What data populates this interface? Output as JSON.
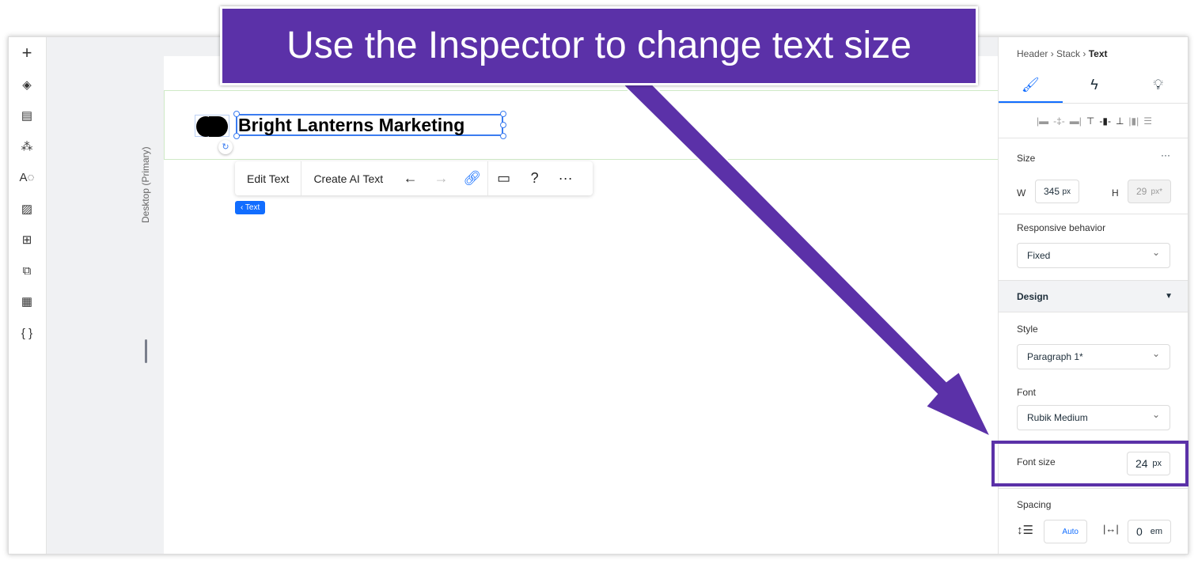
{
  "callout": {
    "text": "Use the Inspector to change text size",
    "color": "#5b31a8"
  },
  "leftbar": {
    "icons": [
      "plus-icon",
      "layers-icon",
      "page-icon",
      "components-icon",
      "typography-icon",
      "image-icon",
      "apps-icon",
      "app-market-icon",
      "table-icon",
      "code-icon"
    ]
  },
  "canvas": {
    "viewport_label": "Desktop (Primary)",
    "site_title": "Bright Lanterns Marketing",
    "breadcrumb_tag": "‹ Text"
  },
  "toolbar": {
    "edit_text": "Edit Text",
    "create_ai_text": "Create AI Text"
  },
  "inspector": {
    "breadcrumb": [
      "Header",
      "Stack",
      "Text"
    ],
    "size": {
      "label": "Size",
      "more": "···",
      "w_label": "W",
      "w_value": "345",
      "w_unit": "px",
      "h_label": "H",
      "h_value": "29",
      "h_unit": "px*"
    },
    "responsive": {
      "label": "Responsive behavior",
      "value": "Fixed"
    },
    "design": {
      "label": "Design"
    },
    "style": {
      "label": "Style",
      "value": "Paragraph 1*"
    },
    "font": {
      "label": "Font",
      "value": "Rubik Medium"
    },
    "font_size": {
      "label": "Font size",
      "value": "24",
      "unit": "px"
    },
    "spacing": {
      "label": "Spacing",
      "line_value": "Auto",
      "letter_value": "0",
      "letter_unit": "em"
    }
  },
  "accent": "#116dff"
}
